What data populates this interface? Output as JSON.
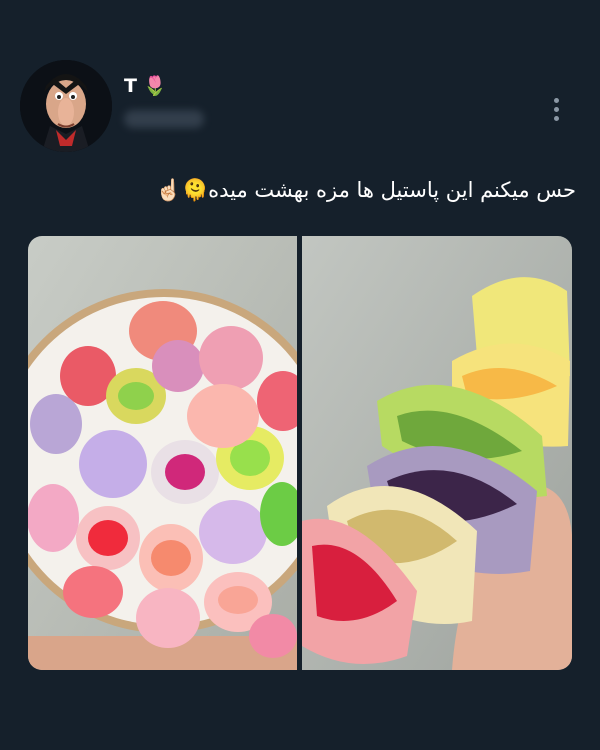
{
  "tweet": {
    "author_name": "T",
    "author_name_emoji": "🌷",
    "handle": "",
    "text": "حس میکنم این پاستیل ها مزه بهشت میده🫠☝🏻",
    "icons": {
      "avatar": "cartoon-avatar",
      "more": "more-vertical-icon"
    }
  },
  "photos": [
    {
      "subject": "candy-bowl-image"
    },
    {
      "subject": "candy-stack-image"
    }
  ],
  "colors": {
    "background": "#15202b",
    "text": "#ffffff",
    "secondary": "#8b98a5"
  }
}
